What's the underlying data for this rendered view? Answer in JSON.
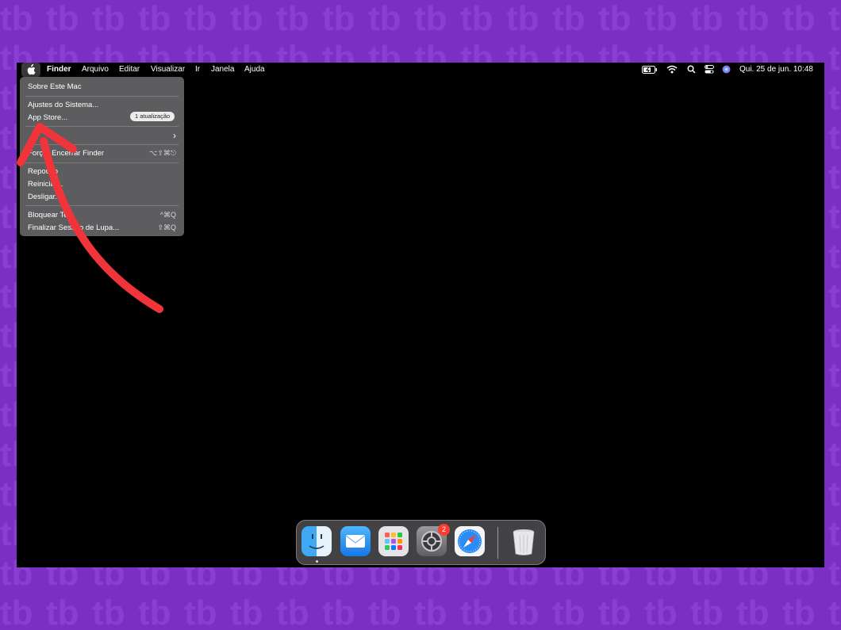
{
  "menubar": {
    "items": [
      "Finder",
      "Arquivo",
      "Editar",
      "Visualizar",
      "Ir",
      "Janela",
      "Ajuda"
    ],
    "datetime": "Qui. 25 de jun.  10:48"
  },
  "apple_menu": {
    "about": "Sobre Este Mac",
    "settings": "Ajustes do Sistema...",
    "appstore": "App Store...",
    "appstore_badge": "1 atualização",
    "force_quit": "Forçar Encerrar Finder",
    "force_quit_shortcut": "⌥⇧⌘⎋",
    "sleep": "Repouso",
    "restart": "Reiniciar...",
    "shutdown": "Desligar...",
    "lock": "Bloquear Tela",
    "lock_shortcut": "^⌘Q",
    "logout": "Finalizar Sessão de Lupa...",
    "logout_shortcut": "⇧⌘Q"
  },
  "dock": {
    "items": [
      "finder",
      "mail",
      "launchpad",
      "system-settings",
      "safari",
      "trash"
    ],
    "settings_badge": "2"
  },
  "colors": {
    "background": "#7c2fc4",
    "menu": "#5d5d5f",
    "arrow": "#f0343a",
    "badge": "#ff3b30"
  }
}
